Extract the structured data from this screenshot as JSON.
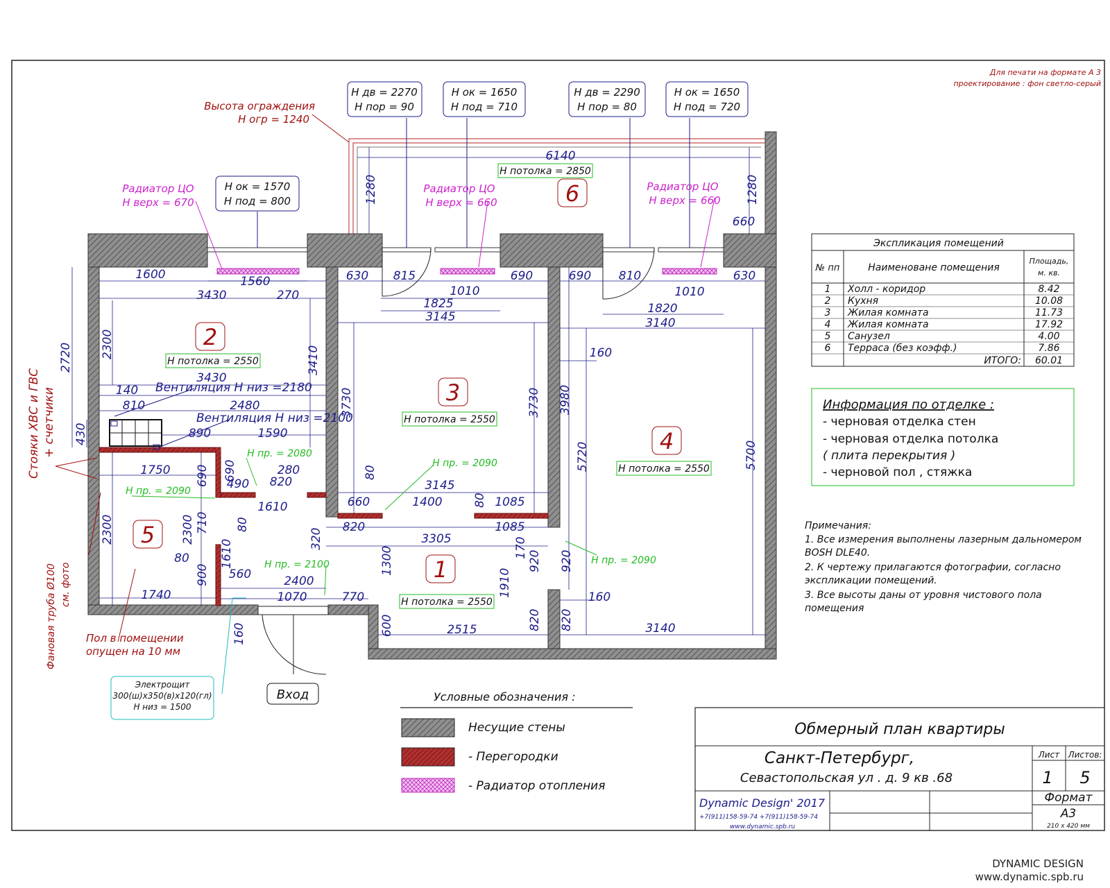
{
  "notes_print": {
    "line1": "Для печати на формате А 3",
    "line2": "проектирование : фон светло-серый"
  },
  "fence": {
    "line1": "Высота ограждения",
    "line2": "Н огр = 1240"
  },
  "openings": {
    "o1": {
      "l1": "Н дв = 2270",
      "l2": "Н пор = 90"
    },
    "o2": {
      "l1": "Н ок = 1650",
      "l2": "Н под = 710"
    },
    "o3": {
      "l1": "Н дв = 2290",
      "l2": "Н пор = 80"
    },
    "o4": {
      "l1": "Н ок = 1650",
      "l2": "Н под = 720"
    },
    "o5": {
      "l1": "Н ок = 1570",
      "l2": "Н под = 800"
    }
  },
  "radiators": {
    "r1": {
      "l1": "Радиатор ЦО",
      "l2": "Н верх = 670"
    },
    "r2": {
      "l1": "Радиатор ЦО",
      "l2": "Н верх = 660"
    },
    "r3": {
      "l1": "Радиатор ЦО",
      "l2": "Н верх = 660"
    }
  },
  "rooms": {
    "n1": "1",
    "n2": "2",
    "n3": "3",
    "n4": "4",
    "n5": "5",
    "n6": "6",
    "c1": "Н потолка = 2550",
    "c2": "Н потолка = 2550",
    "c3": "Н потолка = 2550",
    "c4": "Н потолка = 2550",
    "c6": "Н потолка = 2850"
  },
  "passages": {
    "p1": "Н пр. =  2080",
    "p2": "Н пр. =  2090",
    "p3": "Н пр. =  2090",
    "p4": "Н пр. =  2100",
    "p5": "Н пр. =  2090"
  },
  "ventilation": {
    "v1": "Вентиляция Н низ  =2180",
    "v2": "Вентиляция Н низ  =2100"
  },
  "side_labels": {
    "risers_l1": "Стояки ХВС  и ГВС",
    "risers_l2": "+ счетчики",
    "pipe_l1": "Фановая труба  Ø100",
    "pipe_l2": "см. фото",
    "floor_l1": "Пол в помещении",
    "floor_l2": "опущен на 10 мм"
  },
  "electro": {
    "l1": "Электрощит",
    "l2": "300(ш)х350(в)х120(гл)",
    "l3": "Н низ = 1500"
  },
  "entrance": "Вход",
  "dims": {
    "d6140": "6140",
    "d1280a": "1280",
    "d1280b": "1280",
    "d660": "660",
    "d1600": "1600",
    "d1560": "1560",
    "d3430a": "3430",
    "d270": "270",
    "d2720": "2720",
    "d2300a": "2300",
    "d3410": "3410",
    "d3430b": "3430",
    "d140": "140",
    "d810a": "810",
    "d2480": "2480",
    "d430": "430",
    "d890": "890",
    "d1590": "1590",
    "d630a": "630",
    "d815": "815",
    "d1010a": "1010",
    "d690a": "690",
    "d1825": "1825",
    "d3145a": "3145",
    "d3730a": "3730",
    "d3730b": "3730",
    "d80a": "80",
    "d3145b": "3145",
    "d660b": "660",
    "d1400": "1400",
    "d80b": "80",
    "d1085a": "1085",
    "d820a": "820",
    "d1085b": "1085",
    "d3305": "3305",
    "d320": "320",
    "d690b": "690",
    "d810b": "810",
    "d1010b": "1010",
    "d630b": "630",
    "d1820": "1820",
    "d3140a": "3140",
    "d160a": "160",
    "d3980": "3980",
    "d5720": "5720",
    "d5700": "5700",
    "d160b": "160",
    "d920a": "920",
    "d920b": "920",
    "d170": "170",
    "d3140b": "3140",
    "d1750": "1750",
    "d690c": "690",
    "d690d": "690",
    "d490": "490",
    "d280": "280",
    "d820b": "820",
    "d1610a": "1610",
    "d2300b": "2300",
    "d2300c": "2300",
    "d710": "710",
    "d80c": "80",
    "d80d": "80",
    "d1610b": "1610",
    "d900": "900",
    "d1740": "1740",
    "d560": "560",
    "d2400": "2400",
    "d1070": "1070",
    "d770": "770",
    "d1300": "1300",
    "d1910": "1910",
    "d600": "600",
    "d2515": "2515",
    "d820c": "820",
    "d820d": "820",
    "d160c": "160"
  },
  "explication": {
    "title": "Экспликация помещений",
    "col_num": "№ пп",
    "col_name": "Наименоване помещения",
    "col_area_l1": "Площадь,",
    "col_area_l2": "м. кв.",
    "rows": [
      {
        "n": "1",
        "name": "Холл - коридор",
        "area": "8.42"
      },
      {
        "n": "2",
        "name": "Кухня",
        "area": "10.08"
      },
      {
        "n": "3",
        "name": "Жилая комната",
        "area": "11.73"
      },
      {
        "n": "4",
        "name": "Жилая комната",
        "area": "17.92"
      },
      {
        "n": "5",
        "name": "Санузел",
        "area": "4.00"
      },
      {
        "n": "6",
        "name": "Терраса (без коэфф.)",
        "area": "7.86"
      }
    ],
    "total_label": "ИТОГО:",
    "total": "60.01"
  },
  "finish": {
    "title": "Информация по отделке :",
    "l1": "- черновая отделка стен",
    "l2": "- черновая отделка потолка",
    "l3": "( плита перекрытия  )",
    "l4": "- черновой пол , стяжка"
  },
  "remarks": {
    "title": "Примечания:",
    "l1": "1. Все измерения выполнены лазерным дальномером",
    "l2": "BOSH DLE40.",
    "l3": "2. К чертежу прилагаются фотографии, согласно",
    "l4": "экспликации помещений.",
    "l5": "3. Все высоты даны от уровня чистового пола",
    "l6": "помещения"
  },
  "legend": {
    "title": "Условные обозначения :",
    "walls": "Несущие стены",
    "partitions": "- Перегородки",
    "radiator": "- Радиатор отопления"
  },
  "stamp": {
    "title": "Обмерный план квартиры",
    "city": "Санкт-Петербург,",
    "address": "Севастопольская ул . д. 9 кв .68",
    "sheet_label": "Лист",
    "sheets_label": "Листов:",
    "sheet": "1",
    "sheets": "5",
    "format_label": "Формат",
    "format": "А3",
    "format_size": "210 х 420 мм",
    "company": "Dynamic Design' 2017",
    "phones": "+7(911)158-59-74     +7(911)158-59-74",
    "site": "www.dynamic.spb.ru"
  },
  "footer": {
    "l1": "DYNAMIC DESIGN",
    "l2": "www.dynamic.spb.ru"
  }
}
